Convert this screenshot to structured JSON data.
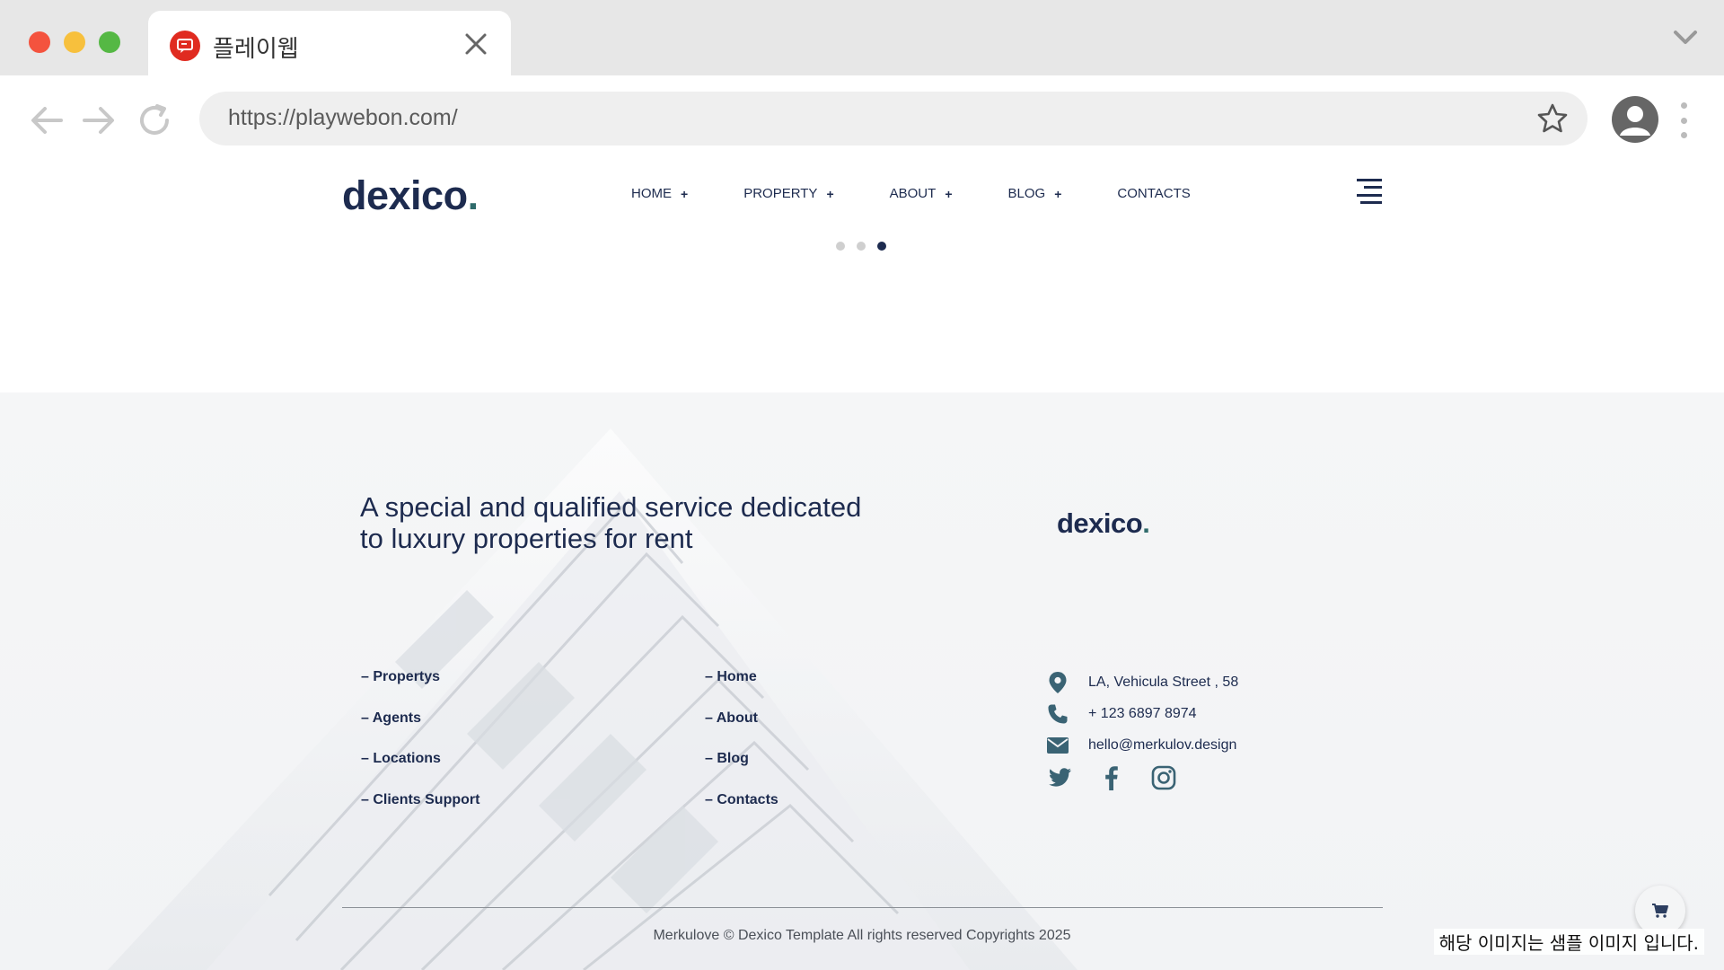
{
  "browser": {
    "tab_title": "플레이웹",
    "url": "https://playwebon.com/"
  },
  "site": {
    "logo_text": "dexico",
    "logo_dot": ".",
    "nav": [
      {
        "label": "HOME",
        "plus": "+"
      },
      {
        "label": "PROPERTY",
        "plus": "+"
      },
      {
        "label": "ABOUT",
        "plus": "+"
      },
      {
        "label": "BLOG",
        "plus": "+"
      },
      {
        "label": "CONTACTS",
        "plus": ""
      }
    ],
    "slider_dots": 3,
    "slider_active": 3
  },
  "footer": {
    "tagline_line1": "A special and qualified service dedicated",
    "tagline_line2": "to luxury properties for rent",
    "logo_text": "dexico",
    "logo_dot": ".",
    "links_col1": [
      "– Propertys",
      "– Agents",
      "– Locations",
      "– Clients Support"
    ],
    "links_col2": [
      "– Home",
      "– About",
      "– Blog",
      "– Contacts"
    ],
    "address": "LA, Vehicula Street , 58",
    "phone": "+ 123 6897 8974",
    "email": "hello@merkulov.design",
    "copyright": "Merkulove © Dexico Template All rights reserved Copyrights 2025"
  },
  "overlay": {
    "sample_note": "해당 이미지는 샘플 이미지 입니다."
  },
  "colors": {
    "brand_navy": "#1d2b4f",
    "brand_teal": "#2f6b6b",
    "contact_icon": "#3a6374"
  }
}
